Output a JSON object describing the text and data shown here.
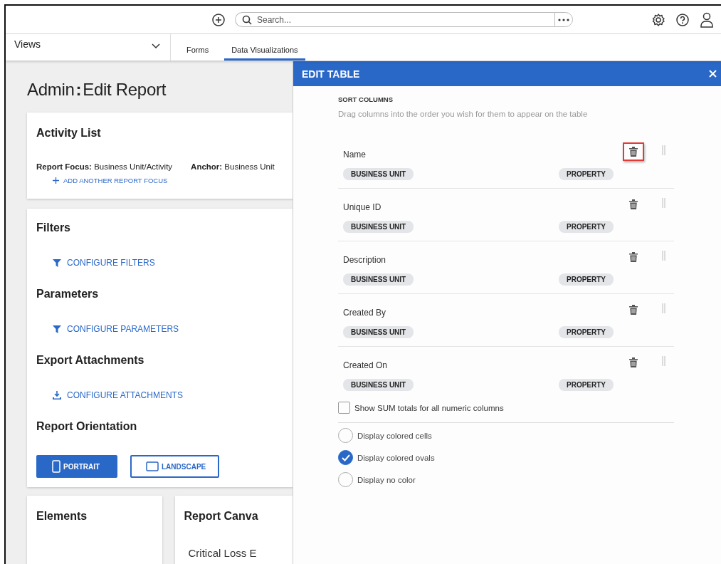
{
  "top_bar": {
    "search": {
      "placeholder": "Search..."
    }
  },
  "nav": {
    "views_label": "Views",
    "tabs": [
      {
        "label": "Forms",
        "selected": false
      },
      {
        "label": "Data Visualizations",
        "selected": true
      }
    ]
  },
  "page": {
    "title_prefix": "Admin",
    "title_separator": ":",
    "title": "Edit Report",
    "activity_card": {
      "title": "Activity List",
      "focus_label": "Report Focus:",
      "focus_value": "Business Unit/Activity",
      "anchor_label": "Anchor:",
      "anchor_value": "Business Unit",
      "add_link": "ADD ANOTHER REPORT FOCUS"
    },
    "sections": [
      {
        "title": "Filters",
        "link": "CONFIGURE FILTERS",
        "kind": "filter"
      },
      {
        "title": "Parameters",
        "link": "CONFIGURE PARAMETERS",
        "kind": "filter"
      },
      {
        "title": "Export Attachments",
        "link": "CONFIGURE ATTACHMENTS",
        "kind": "download"
      }
    ],
    "orientation": {
      "title": "Report Orientation",
      "options": [
        {
          "label": "PORTRAIT",
          "selected": true
        },
        {
          "label": "LANDSCAPE",
          "selected": false
        }
      ]
    },
    "elements_title": "Elements",
    "canvas_title": "Report Canva",
    "canvas_item": "Critical Loss E"
  },
  "panel": {
    "title": "EDIT TABLE",
    "sort_heading": "SORT COLUMNS",
    "sort_hint": "Drag columns into the order you wish for them to appear on the table",
    "columns": [
      {
        "name": "Name",
        "source": "BUSINESS UNIT",
        "type": "PROPERTY",
        "highlighted": true
      },
      {
        "name": "Unique ID",
        "source": "BUSINESS UNIT",
        "type": "PROPERTY",
        "highlighted": false
      },
      {
        "name": "Description",
        "source": "BUSINESS UNIT",
        "type": "PROPERTY",
        "highlighted": false
      },
      {
        "name": "Created By",
        "source": "BUSINESS UNIT",
        "type": "PROPERTY",
        "highlighted": false
      },
      {
        "name": "Created On",
        "source": "BUSINESS UNIT",
        "type": "PROPERTY",
        "highlighted": false
      }
    ],
    "sum_totals": {
      "label": "Show SUM totals for all numeric columns",
      "checked": false
    },
    "color_options": [
      {
        "label": "Display colored cells",
        "selected": false
      },
      {
        "label": "Display colored ovals",
        "selected": true
      },
      {
        "label": "Display no color",
        "selected": false
      }
    ]
  }
}
